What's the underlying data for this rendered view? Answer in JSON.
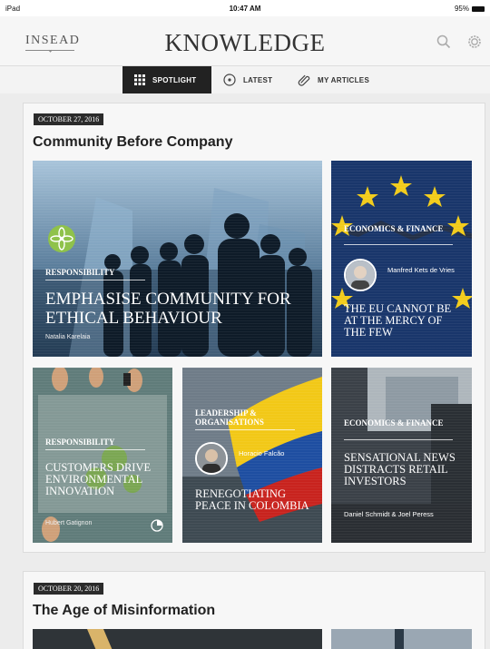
{
  "status": {
    "device": "iPad",
    "time": "10:47 AM",
    "battery": "95%"
  },
  "header": {
    "logo": "INSEAD",
    "title": "KNOWLEDGE",
    "search_icon": "search-icon",
    "settings_icon": "gear-icon"
  },
  "tabs": [
    {
      "label": "SPOTLIGHT",
      "icon": "grid-icon",
      "active": true
    },
    {
      "label": "LATEST",
      "icon": "clock-icon",
      "active": false
    },
    {
      "label": "MY ARTICLES",
      "icon": "paperclip-icon",
      "active": false
    }
  ],
  "sections": [
    {
      "date": "OCTOBER 27, 2016",
      "title": "Community Before Company",
      "cards": [
        {
          "category": "RESPONSIBILITY",
          "headline": "EMPHASISE COMMUNITY FOR ETHICAL BEHAVIOUR",
          "author": "Natalia Karelaia",
          "badge_icon": "leaf-icon"
        },
        {
          "category": "ECONOMICS & FINANCE",
          "author": "Manfred Kets de Vries",
          "headline": "THE EU CANNOT BE AT THE MERCY OF THE FEW"
        },
        {
          "category": "RESPONSIBILITY",
          "headline": "CUSTOMERS DRIVE ENVIRONMENTAL INNOVATION",
          "author": "Hubert Gatignon"
        },
        {
          "category": "LEADERSHIP & ORGANISATIONS",
          "author": "Horacio Falcão",
          "headline": "RENEGOTIATING PEACE IN COLOMBIA"
        },
        {
          "category": "ECONOMICS & FINANCE",
          "headline": "SENSATIONAL NEWS DISTRACTS RETAIL INVESTORS",
          "author": "Daniel Schmidt & Joel Peress"
        }
      ]
    },
    {
      "date": "OCTOBER 20, 2016",
      "title": "The Age of Misinformation"
    }
  ]
}
